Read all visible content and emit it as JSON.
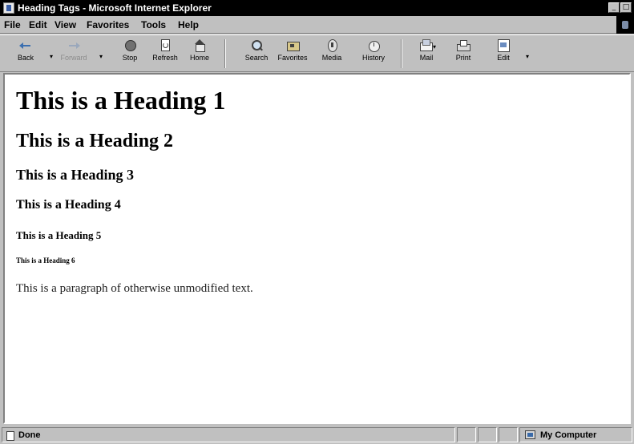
{
  "window": {
    "title": "Heading Tags - Microsoft Internet Explorer",
    "controls": {
      "minimize": "_",
      "maximize": "□"
    }
  },
  "menu": {
    "items": [
      "File",
      "Edit",
      "View",
      "Favorites",
      "Tools",
      "Help"
    ]
  },
  "toolbar": {
    "buttons": [
      {
        "label": "Back",
        "icon": "back-arrow-icon"
      },
      {
        "label": "Forward",
        "icon": "forward-arrow-icon",
        "disabled": true
      },
      {
        "label": "Stop",
        "icon": "stop-icon"
      },
      {
        "label": "Refresh",
        "icon": "refresh-icon"
      },
      {
        "label": "Home",
        "icon": "home-icon"
      },
      {
        "label": "Search",
        "icon": "search-icon"
      },
      {
        "label": "Favorites",
        "icon": "favorites-icon"
      },
      {
        "label": "Media",
        "icon": "media-icon"
      },
      {
        "label": "History",
        "icon": "history-icon"
      },
      {
        "label": "Mail",
        "icon": "mail-icon"
      },
      {
        "label": "Print",
        "icon": "print-icon"
      },
      {
        "label": "Edit",
        "icon": "edit-icon"
      }
    ],
    "dropdown_glyph": "▾"
  },
  "document": {
    "h1": "This is a Heading 1",
    "h2": "This is a Heading 2",
    "h3": "This is a Heading 3",
    "h4": "This is a Heading 4",
    "h5": "This is a Heading 5",
    "h6": "This is a Heading 6",
    "paragraph": "This is a paragraph of otherwise unmodified text."
  },
  "status": {
    "text": "Done",
    "zone": "My Computer"
  },
  "colors": {
    "titlebar": "#000000",
    "chrome": "#c0c0c0",
    "content_bg": "#ffffff"
  }
}
